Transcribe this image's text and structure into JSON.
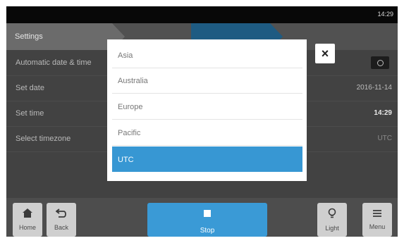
{
  "status_bar": {
    "time": "14:29"
  },
  "tabs": {
    "settings_label": "Settings"
  },
  "settings": {
    "rows": [
      {
        "label": "Automatic date & time"
      },
      {
        "label": "Set date",
        "value": "2016-11-14"
      },
      {
        "label": "Set time",
        "value": "14:29"
      },
      {
        "label": "Select timezone",
        "value": "UTC"
      }
    ]
  },
  "timezone_dropdown": {
    "options": [
      "Asia",
      "Australia",
      "Europe",
      "Pacific",
      "UTC"
    ],
    "selected": "UTC",
    "close_icon": "×"
  },
  "bottom_bar": {
    "home_label": "Home",
    "back_label": "Back",
    "stop_label": "Stop",
    "light_label": "Light",
    "menu_label": "Menu"
  },
  "colors": {
    "accent": "#3797d3",
    "active_tab": "#1e5b82",
    "stop_button": "#3a9ad6"
  }
}
